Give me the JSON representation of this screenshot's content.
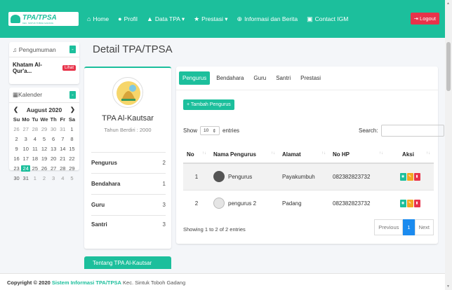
{
  "brand": {
    "name": "TPA/TPSA",
    "tagline": "KEC. SINTUK TOBOH GADANG"
  },
  "nav": {
    "items": [
      {
        "label": "Home",
        "icon": "home-icon"
      },
      {
        "label": "Profil",
        "icon": "user-icon"
      },
      {
        "label": "Data TPA ▾",
        "icon": "graduation-cap-icon"
      },
      {
        "label": "Prestasi ▾",
        "icon": "star-icon"
      },
      {
        "label": "Informasi dan Berita",
        "icon": "globe-icon"
      },
      {
        "label": "Contact IGM",
        "icon": "id-card-icon"
      }
    ],
    "logout": "Logout"
  },
  "announcement": {
    "header": "Pengumuman",
    "item": "Khatam Al-Qur'a...",
    "badge": "Lihat"
  },
  "calendar": {
    "header": "Kalender",
    "month": "August 2020",
    "dow": [
      "Su",
      "Mo",
      "Tu",
      "We",
      "Th",
      "Fr",
      "Sa"
    ],
    "weeks": [
      [
        "26",
        "27",
        "28",
        "29",
        "30",
        "31",
        "1"
      ],
      [
        "2",
        "3",
        "4",
        "5",
        "6",
        "7",
        "8"
      ],
      [
        "9",
        "10",
        "11",
        "12",
        "13",
        "14",
        "15"
      ],
      [
        "16",
        "17",
        "18",
        "19",
        "20",
        "21",
        "22"
      ],
      [
        "23",
        "24",
        "25",
        "26",
        "27",
        "28",
        "29"
      ],
      [
        "30",
        "31",
        "1",
        "2",
        "3",
        "4",
        "5"
      ]
    ],
    "today": "24"
  },
  "page": {
    "title": "Detail TPA/TPSA"
  },
  "profile": {
    "name": "TPA Al-Kautsar",
    "subtitle": "Tahun Berdiri : 2000",
    "stats": [
      {
        "label": "Pengurus",
        "value": "2"
      },
      {
        "label": "Bendahara",
        "value": "1"
      },
      {
        "label": "Guru",
        "value": "3"
      },
      {
        "label": "Santri",
        "value": "3"
      }
    ],
    "about": "Tentang TPA Al-Kautsar"
  },
  "tabs": [
    "Pengurus",
    "Bendahara",
    "Guru",
    "Santri",
    "Prestasi"
  ],
  "add_button": "+ Tambah Pengurus",
  "show": {
    "prefix": "Show",
    "value": "10",
    "suffix": "entries"
  },
  "search": {
    "label": "Search:"
  },
  "table": {
    "headers": [
      "No",
      "Nama Pengurus",
      "Alamat",
      "No HP",
      "Aksi"
    ],
    "rows": [
      {
        "no": "1",
        "nama": "Pengurus",
        "alamat": "Payakumbuh",
        "hp": "082382823732"
      },
      {
        "no": "2",
        "nama": "pengurus 2",
        "alamat": "Padang",
        "hp": "082382823732"
      }
    ]
  },
  "info": "Showing 1 to 2 of 2 entries",
  "pagination": {
    "prev": "Previous",
    "current": "1",
    "next": "Next"
  },
  "footer": {
    "copyright": "Copyright © 2020",
    "system": "Sistem Informasi TPA/TPSA",
    "location": "Kec. Sintuk Toboh Gadang"
  },
  "colors": {
    "accent": "#1cbf9c",
    "danger": "#e8334a",
    "warning": "#f5a623",
    "primary": "#1b8bef"
  }
}
